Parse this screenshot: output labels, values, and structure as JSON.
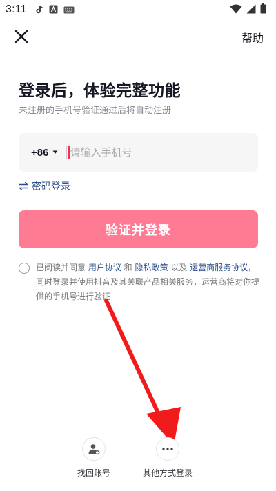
{
  "status_bar": {
    "time": "3:11",
    "left_icons": [
      "tiktok-icon",
      "a-badge-icon",
      "keyboard-icon"
    ],
    "right_icons": [
      "wifi-icon",
      "signal-icon",
      "battery-icon"
    ]
  },
  "top_bar": {
    "close_icon": "close-icon",
    "help_label": "帮助"
  },
  "header": {
    "title": "登录后，体验完整功能",
    "subtitle": "未注册的手机号验证通过后将自动注册"
  },
  "phone_input": {
    "country_code": "+86",
    "placeholder": "请输入手机号",
    "value": ""
  },
  "password_login": {
    "icon": "swap-icon",
    "label": "密码登录"
  },
  "submit": {
    "label": "验证并登录",
    "color": "#fe7b93"
  },
  "agreement": {
    "checked": false,
    "prefix": "已阅读并同意 ",
    "user_agreement": "用户协议",
    "and": " 和 ",
    "privacy_policy": "隐私政策",
    "and2": " 以及 ",
    "carrier_agreement": "运营商服务协议",
    "suffix": "，同时登录并使用抖音及其关联产品相关服务，运营商将对你提供的手机号进行验证"
  },
  "bottom_options": [
    {
      "icon": "user-recover-icon",
      "label": "找回账号"
    },
    {
      "icon": "more-dots-icon",
      "label": "其他方式登录"
    }
  ],
  "annotation": {
    "arrow_color": "#f21b1b"
  }
}
